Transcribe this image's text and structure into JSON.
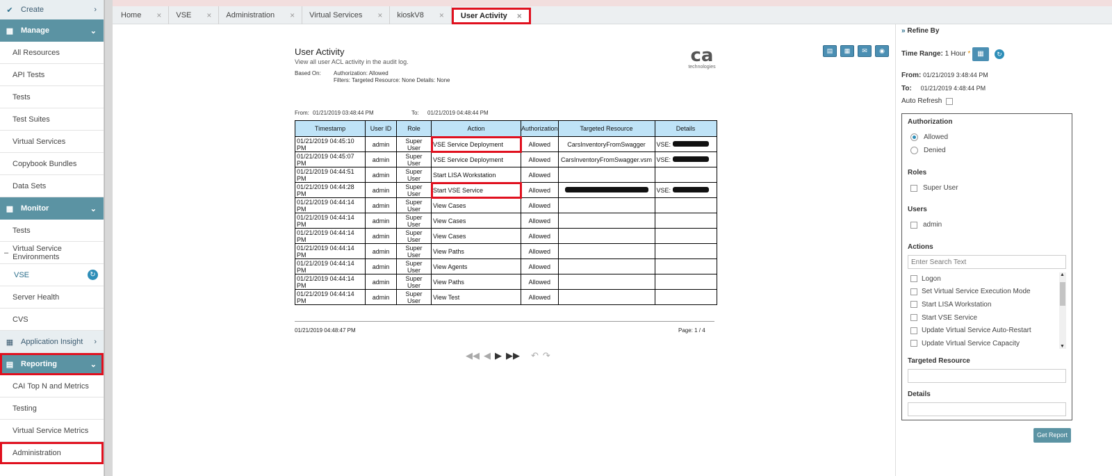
{
  "sidebar": {
    "create": "Create",
    "manage": "Manage",
    "manage_items": [
      "All Resources",
      "API Tests",
      "Tests",
      "Test Suites",
      "Virtual Services",
      "Copybook Bundles",
      "Data Sets"
    ],
    "monitor": "Monitor",
    "monitor_tests": "Tests",
    "vse_group": "Virtual Service Environments",
    "vse": "VSE",
    "server_health": "Server Health",
    "cvs": "CVS",
    "app_insight": "Application Insight",
    "reporting": "Reporting",
    "reporting_items": [
      "CAI Top N and Metrics",
      "Testing",
      "Virtual Service Metrics",
      "Administration"
    ]
  },
  "tabs": [
    "Home",
    "VSE",
    "Administration",
    "Virtual Services",
    "kioskV8",
    "User Activity"
  ],
  "report": {
    "title": "User Activity",
    "subtitle": "View all user ACL activity in the audit log.",
    "based_on_label": "Based On:",
    "authorization_line": "Authorization: Allowed",
    "filters_line": "Filters:   Targeted Resource: None   Details: None",
    "from_label": "From:",
    "from_value": "01/21/2019 03:48:44 PM",
    "to_label": "To:",
    "to_value": "01/21/2019 04:48:44 PM",
    "logo_big": "ca",
    "logo_small": "technologies",
    "columns": [
      "Timestamp",
      "User ID",
      "Role",
      "Action",
      "Authorization",
      "Targeted Resource",
      "Details"
    ],
    "rows": [
      {
        "ts1": "01/21/2019 04:45:10",
        "ts2": "PM",
        "user": "admin",
        "role": "Super User",
        "action": "VSE Service Deployment",
        "auth": "Allowed",
        "target": "CarsInventoryFromSwagger",
        "details": "VSE: "
      },
      {
        "ts1": "01/21/2019 04:45:07",
        "ts2": "PM",
        "user": "admin",
        "role": "Super User",
        "action": "VSE Service Deployment",
        "auth": "Allowed",
        "target": "CarsInventoryFromSwagger.vsm",
        "details": "VSE: "
      },
      {
        "ts1": "01/21/2019 04:44:51",
        "ts2": "PM",
        "user": "admin",
        "role": "Super User",
        "action": "Start LISA Workstation",
        "auth": "Allowed",
        "target": "",
        "details": ""
      },
      {
        "ts1": "01/21/2019 04:44:28",
        "ts2": "PM",
        "user": "admin",
        "role": "Super User",
        "action": "Start VSE Service",
        "auth": "Allowed",
        "target": "",
        "details": "VSE: "
      },
      {
        "ts1": "01/21/2019 04:44:14",
        "ts2": "PM",
        "user": "admin",
        "role": "Super User",
        "action": "View Cases",
        "auth": "Allowed",
        "target": "",
        "details": ""
      },
      {
        "ts1": "01/21/2019 04:44:14",
        "ts2": "PM",
        "user": "admin",
        "role": "Super User",
        "action": "View Cases",
        "auth": "Allowed",
        "target": "",
        "details": ""
      },
      {
        "ts1": "01/21/2019 04:44:14",
        "ts2": "PM",
        "user": "admin",
        "role": "Super User",
        "action": "View Cases",
        "auth": "Allowed",
        "target": "",
        "details": ""
      },
      {
        "ts1": "01/21/2019 04:44:14",
        "ts2": "PM",
        "user": "admin",
        "role": "Super User",
        "action": "View Paths",
        "auth": "Allowed",
        "target": "",
        "details": ""
      },
      {
        "ts1": "01/21/2019 04:44:14",
        "ts2": "PM",
        "user": "admin",
        "role": "Super User",
        "action": "View Agents",
        "auth": "Allowed",
        "target": "",
        "details": ""
      },
      {
        "ts1": "01/21/2019 04:44:14",
        "ts2": "PM",
        "user": "admin",
        "role": "Super User",
        "action": "View Paths",
        "auth": "Allowed",
        "target": "",
        "details": ""
      },
      {
        "ts1": "01/21/2019 04:44:14",
        "ts2": "PM",
        "user": "admin",
        "role": "Super User",
        "action": "View Test",
        "auth": "Allowed",
        "target": "",
        "details": ""
      }
    ],
    "generated": "01/21/2019 04:48:47 PM",
    "page": "Page: 1 /    4"
  },
  "refine": {
    "title": "Refine By",
    "time_range_label": "Time Range:",
    "time_range_value": "1 Hour",
    "from_label": "From:",
    "from_value": "01/21/2019 3:48:44 PM",
    "to_label": "To:",
    "to_value": "01/21/2019 4:48:44 PM",
    "auto_refresh": "Auto Refresh",
    "authorization": "Authorization",
    "allowed": "Allowed",
    "denied": "Denied",
    "roles": "Roles",
    "super_user": "Super User",
    "users": "Users",
    "admin": "admin",
    "actions": "Actions",
    "search_placeholder": "Enter Search Text",
    "action_items": [
      "Logon",
      "Set Virtual Service Execution Mode",
      "Start LISA Workstation",
      "Start VSE Service",
      "Update Virtual Service Auto-Restart",
      "Update Virtual Service Capacity"
    ],
    "targeted_resource": "Targeted Resource",
    "details": "Details",
    "get_report": "Get Report"
  },
  "colors": {
    "accent": "#5b93a3",
    "highlight": "#e0101e",
    "header_cell": "#bfe3f7"
  }
}
